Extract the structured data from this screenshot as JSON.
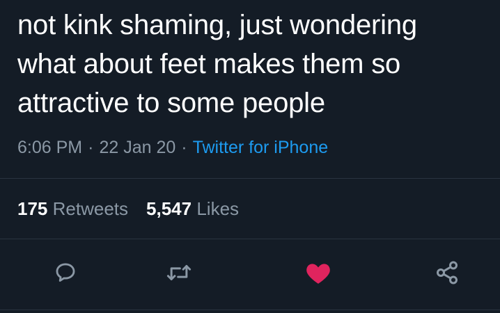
{
  "tweet": {
    "text_lines": [
      "not kink shaming, just wondering",
      "what about feet makes them so",
      "attractive to some people"
    ],
    "time": "6:06 PM",
    "date": "22 Jan 20",
    "separator": "·",
    "source": "Twitter for iPhone"
  },
  "stats": {
    "retweets_count": "175",
    "retweets_label": "Retweets",
    "likes_count": "5,547",
    "likes_label": "Likes"
  },
  "actions": {
    "reply_icon": "reply-bubble-icon",
    "retweet_icon": "retweet-arrows-icon",
    "like_icon": "heart-icon",
    "share_icon": "share-nodes-icon",
    "like_color": "#e0245e",
    "icon_color": "#8b98a5"
  },
  "colors": {
    "background": "#141c26",
    "text": "#ffffff",
    "secondary": "#8b98a5",
    "link": "#1d9bf0"
  }
}
